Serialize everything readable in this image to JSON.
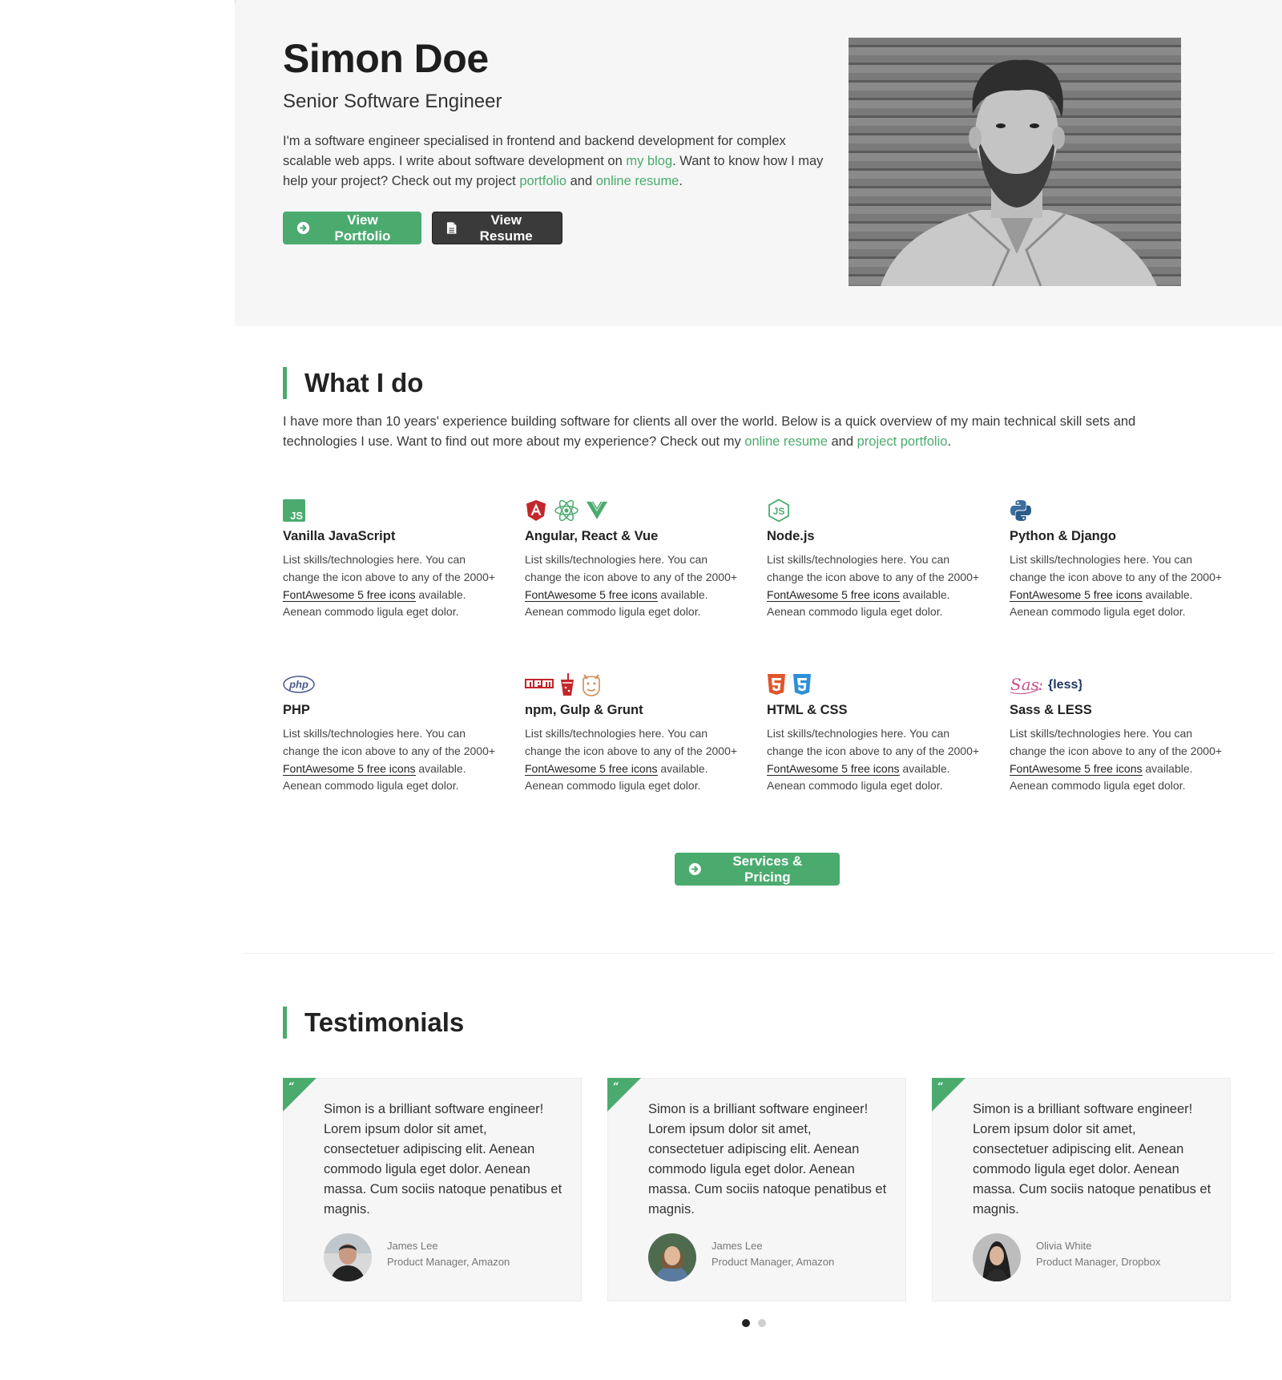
{
  "hero": {
    "name": "Simon Doe",
    "role": "Senior Software Engineer",
    "intro_part1": "I'm a software engineer specialised in frontend and backend development for complex scalable web apps. I write about software development on ",
    "intro_link_blog": "my blog",
    "intro_part2": ". Want to know how I may help your project? Check out my project ",
    "intro_link_portfolio": "portfolio",
    "intro_part3": " and ",
    "intro_link_resume": "online resume",
    "intro_part4": ".",
    "btn_portfolio": "View Portfolio",
    "btn_resume": "View Resume",
    "photo_icon": "profile-photo"
  },
  "whatido": {
    "heading": "What I do",
    "intro_part1": "I have more than 10 years' experience building software for clients all over the world. Below is a quick overview of my main technical skill sets and technologies I use. Want to find out more about my experience? Check out my ",
    "intro_link_resume": "online resume",
    "intro_part2": " and ",
    "intro_link_portfolio": "project portfolio",
    "intro_part3": ".",
    "skills": [
      {
        "title": "Vanilla JavaScript",
        "icons": [
          "js-icon"
        ]
      },
      {
        "title": "Angular, React & Vue",
        "icons": [
          "angular-icon",
          "react-icon",
          "vue-icon"
        ]
      },
      {
        "title": "Node.js",
        "icons": [
          "nodejs-icon"
        ]
      },
      {
        "title": "Python & Django",
        "icons": [
          "python-icon"
        ]
      },
      {
        "title": "PHP",
        "icons": [
          "php-icon"
        ]
      },
      {
        "title": "npm, Gulp & Grunt",
        "icons": [
          "npm-icon",
          "gulp-icon",
          "grunt-icon"
        ]
      },
      {
        "title": "HTML & CSS",
        "icons": [
          "html5-icon",
          "css3-icon"
        ]
      },
      {
        "title": "Sass & LESS",
        "icons": [
          "sass-icon",
          "less-icon"
        ]
      }
    ],
    "skill_desc_part1": "List skills/technologies here. You can change the icon above to any of the 2000+ ",
    "skill_desc_link": "FontAwesome 5 free icons",
    "skill_desc_part2": " available. Aenean commodo ligula eget dolor.",
    "btn_services": "Services & Pricing"
  },
  "testimonials": {
    "heading": "Testimonials",
    "quote": "Simon is a brilliant software engineer! Lorem ipsum dolor sit amet, consectetuer adipiscing elit. Aenean commodo ligula eget dolor. Aenean massa. Cum sociis natoque penatibus et magnis.",
    "items": [
      {
        "name": "James Lee",
        "title": "Product Manager, Amazon"
      },
      {
        "name": "James Lee",
        "title": "Product Manager, Amazon"
      },
      {
        "name": "Olivia White",
        "title": "Product Manager, Dropbox"
      }
    ],
    "quote_mark": "“",
    "active_slide": 1,
    "slide_count": 2
  },
  "colors": {
    "accent": "#4bab6f",
    "dark_button": "#3a3a3a",
    "hero_bg": "#f5f6f5"
  }
}
